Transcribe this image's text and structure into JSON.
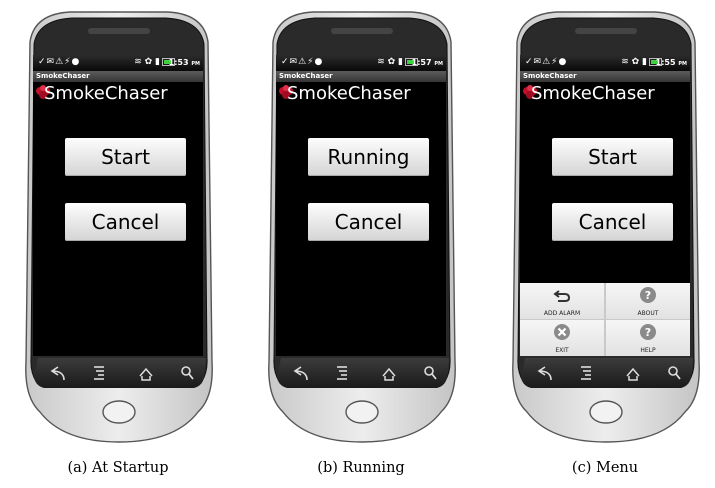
{
  "panels": [
    {
      "status": {
        "time": "1:53",
        "ampm": "PM"
      },
      "titlebar": "SmokeChaser",
      "app_title": "SmokeChaser",
      "primary_button": "Start",
      "cancel_button": "Cancel",
      "caption": "(a) At Startup"
    },
    {
      "status": {
        "time": "1:57",
        "ampm": "PM"
      },
      "titlebar": "SmokeChaser",
      "app_title": "SmokeChaser",
      "primary_button": "Running",
      "cancel_button": "Cancel",
      "caption": "(b) Running"
    },
    {
      "status": {
        "time": "1:55",
        "ampm": "PM"
      },
      "titlebar": "SmokeChaser",
      "app_title": "SmokeChaser",
      "primary_button": "Start",
      "cancel_button": "Cancel",
      "caption": "(c) Menu",
      "menu": {
        "add_alarm": "ADD ALARM",
        "about": "ABOUT",
        "exit": "EXIT",
        "help": "HELP"
      }
    }
  ],
  "icons": {
    "status_left": [
      "missed-call-icon",
      "mail-icon",
      "warning-icon",
      "usb-icon",
      "android-icon"
    ],
    "status_right": [
      "wifi-icon",
      "sync-icon",
      "signal-icon",
      "battery-icon"
    ],
    "app_logo": "red-flower-logo-icon",
    "nav": [
      "back-icon",
      "menu-icon",
      "home-icon",
      "search-icon"
    ],
    "menu": [
      "undo-arrow-icon",
      "question-icon",
      "close-x-icon",
      "question-icon"
    ]
  },
  "colors": {
    "screen_bg": "#000000",
    "button_bg": "#e8e8e8",
    "logo_red": "#c0102a",
    "battery_green": "#3fd23f",
    "menu_bg": "#ececec"
  }
}
